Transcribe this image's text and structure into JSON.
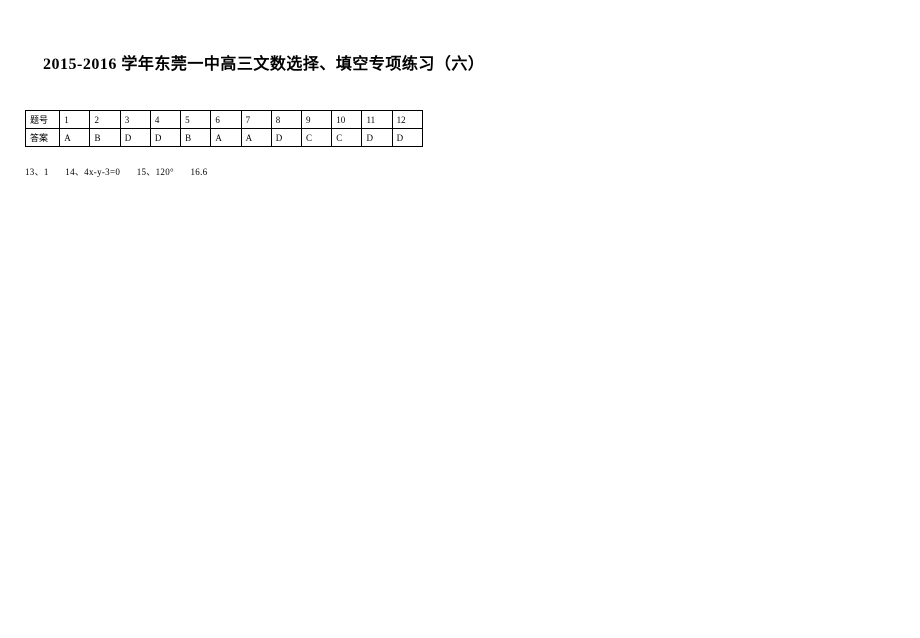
{
  "title": "2015-2016 学年东莞一中高三文数选择、填空专项练习（六）",
  "table": {
    "row1_label": "题号",
    "row2_label": "答案",
    "questions": [
      "1",
      "2",
      "3",
      "4",
      "5",
      "6",
      "7",
      "8",
      "9",
      "10",
      "11",
      "12"
    ],
    "answers": [
      "A",
      "B",
      "D",
      "D",
      "B",
      "A",
      "A",
      "D",
      "C",
      "C",
      "D",
      "D"
    ]
  },
  "fill": {
    "item13": "13、1",
    "item14": "14、4x-y-3=0",
    "item15": "15、120°",
    "item16": "16.6"
  }
}
